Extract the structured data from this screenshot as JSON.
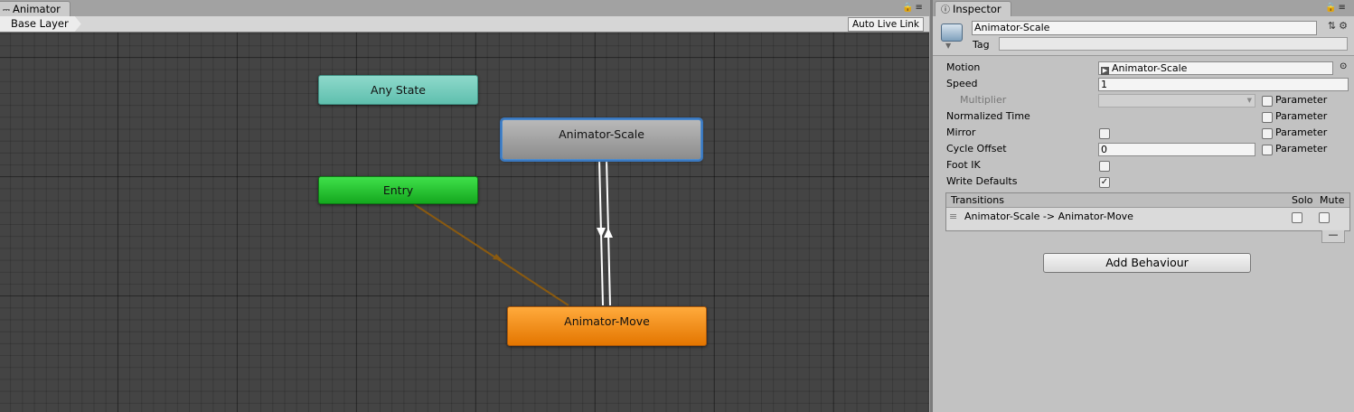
{
  "animator": {
    "tab_label": "Animator",
    "tab_icon": "animator-icon",
    "layer_breadcrumb": "Base Layer",
    "live_link_label": "Auto Live Link",
    "nodes": {
      "any_state": "Any State",
      "entry": "Entry",
      "scale": "Animator-Scale",
      "move": "Animator-Move"
    },
    "colors": {
      "any_state": "#6dc9b8",
      "entry": "#22c22d",
      "default_state": "#a3a3a3",
      "move_state": "#f08a10",
      "entry_link": "#8a5a10",
      "transition_link": "#ffffff",
      "selection_outline": "#3a78bf"
    }
  },
  "inspector": {
    "tab_label": "Inspector",
    "tab_icon": "info-icon",
    "object_name": "Animator-Scale",
    "tag_label": "Tag",
    "fields": {
      "motion_label": "Motion",
      "motion_value": "Animator-Scale",
      "speed_label": "Speed",
      "speed_value": "1",
      "multiplier_label": "Multiplier",
      "normalized_time_label": "Normalized Time",
      "mirror_label": "Mirror",
      "cycle_offset_label": "Cycle Offset",
      "cycle_offset_value": "0",
      "foot_ik_label": "Foot IK",
      "write_defaults_label": "Write Defaults",
      "parameter_label": "Parameter"
    },
    "write_defaults_checked": true,
    "transitions": {
      "header": "Transitions",
      "solo_label": "Solo",
      "mute_label": "Mute",
      "row": "Animator-Scale -> Animator-Move",
      "minus_label": "—"
    },
    "add_behaviour_label": "Add Behaviour"
  }
}
